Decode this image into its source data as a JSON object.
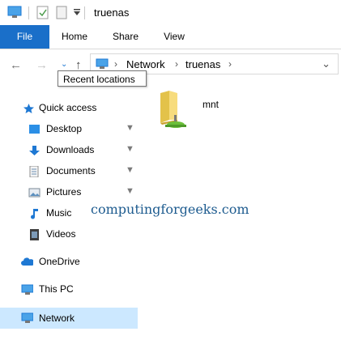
{
  "window": {
    "title": "truenas"
  },
  "ribbon": {
    "tabs": [
      "File",
      "Home",
      "Share",
      "View"
    ]
  },
  "address": {
    "crumbs": [
      "Network",
      "truenas"
    ]
  },
  "tooltip": {
    "text": "Recent locations"
  },
  "nav": {
    "quick_access": "Quick access",
    "items": [
      {
        "label": "Desktop",
        "icon": "desktop-icon",
        "pinned": true
      },
      {
        "label": "Downloads",
        "icon": "downloads-icon",
        "pinned": true
      },
      {
        "label": "Documents",
        "icon": "documents-icon",
        "pinned": true
      },
      {
        "label": "Pictures",
        "icon": "pictures-icon",
        "pinned": true
      },
      {
        "label": "Music",
        "icon": "music-icon",
        "pinned": false
      },
      {
        "label": "Videos",
        "icon": "videos-icon",
        "pinned": false
      }
    ],
    "onedrive": "OneDrive",
    "this_pc": "This PC",
    "network": "Network"
  },
  "content": {
    "items": [
      {
        "name": "mnt",
        "icon": "network-folder-icon"
      }
    ]
  },
  "watermark": "computingforgeeks.com",
  "colors": {
    "file_tab": "#1a6fc9",
    "selected": "#cce8ff",
    "icon_blue": "#1e78d3"
  }
}
